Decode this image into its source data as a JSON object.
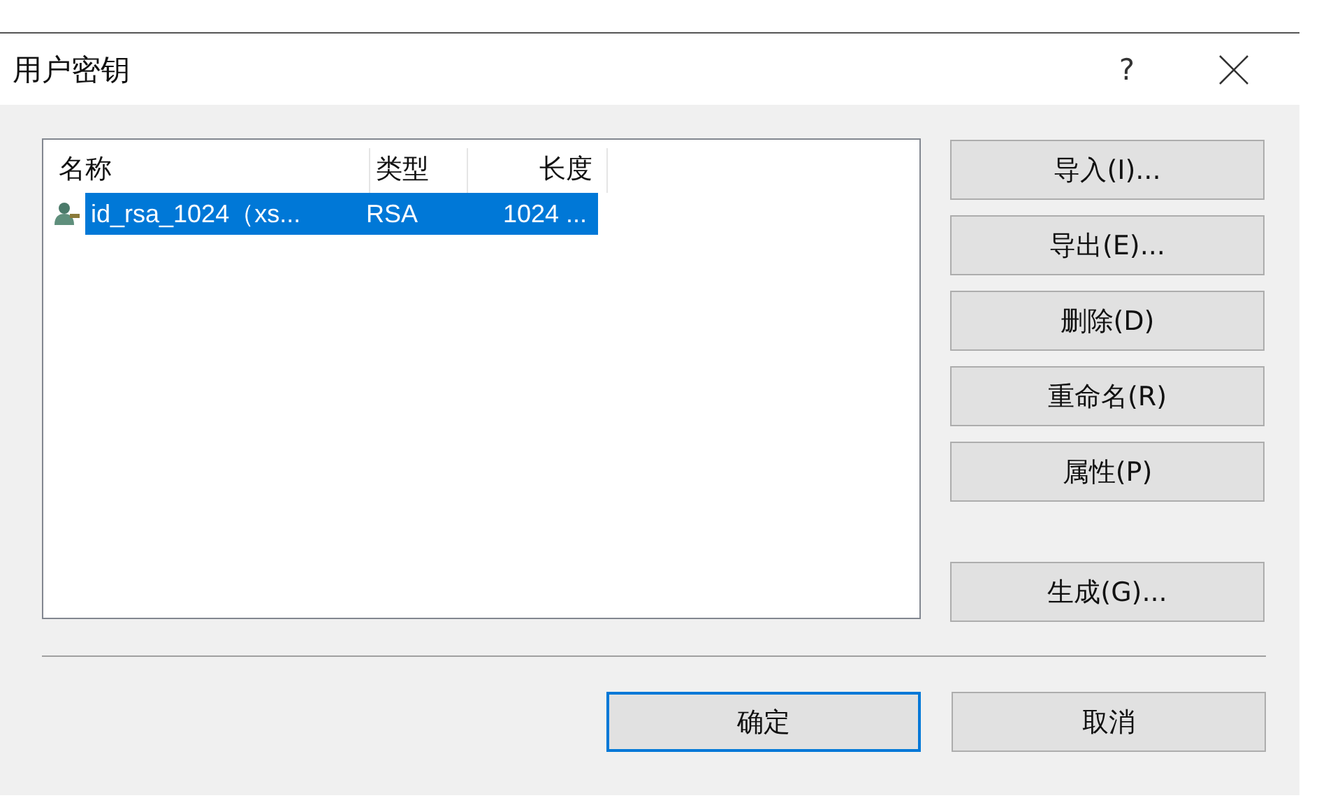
{
  "window": {
    "title": "用户密钥",
    "help": "?"
  },
  "list": {
    "columns": [
      "名称",
      "类型",
      "长度"
    ],
    "rows": [
      {
        "cells": [
          "id_rsa_1024（xs...",
          "RSA",
          "1024 ..."
        ],
        "selected": true
      }
    ]
  },
  "side_button_groups": [
    [
      "导入(I)...",
      "导出(E)...",
      "删除(D)",
      "重命名(R)",
      "属性(P)"
    ],
    [
      "生成(G)..."
    ]
  ],
  "footer_buttons": [
    {
      "label": "确定",
      "default": true
    },
    {
      "label": "取消",
      "default": false
    }
  ]
}
